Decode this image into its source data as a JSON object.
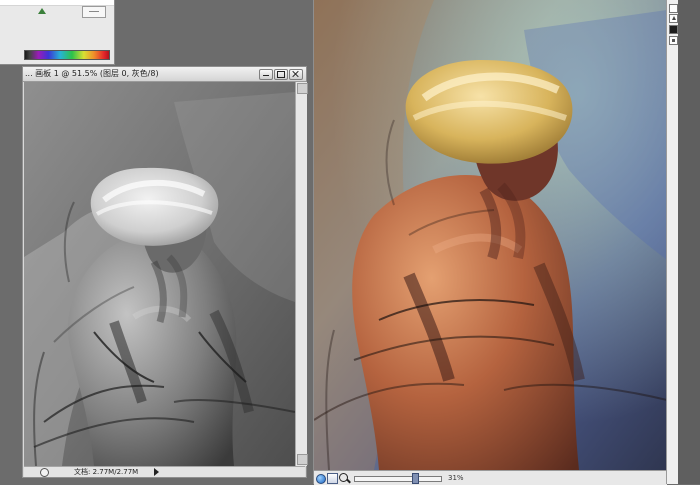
{
  "left_window": {
    "title": "... 画板 1 @ 51.5% (图层 0, 灰色/8)",
    "status_text": "文档: 2.77M/2.77M"
  },
  "right_window": {
    "zoom_text": "31%"
  },
  "colors": {
    "background": "#6c6c6c",
    "left_canvas_gray": "#777777",
    "right_canvas_blue": "#6b6f83",
    "accent_blue": "#1b65c2"
  },
  "icons": {
    "window_minimize": "minimize-icon",
    "window_maximize": "maximize-icon",
    "window_close": "close-icon",
    "status_circle": "circle-icon",
    "status_arrow": "play-arrow-icon",
    "zoom_in": "zoom-icon",
    "hand_tool": "hand-icon",
    "navigator": "navigator-icon",
    "toolbar_button": "square-icon"
  }
}
